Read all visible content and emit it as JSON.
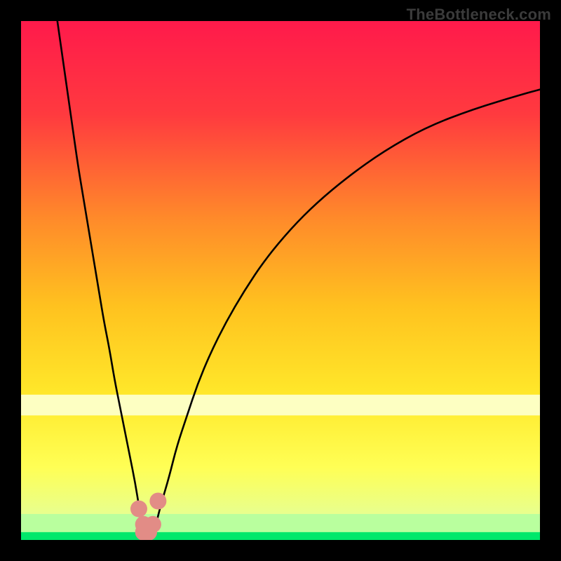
{
  "watermark": "TheBottleneck.com",
  "chart_data": {
    "type": "line",
    "title": "",
    "xlabel": "",
    "ylabel": "",
    "xlim": [
      0,
      100
    ],
    "ylim": [
      0,
      100
    ],
    "grid": false,
    "gradient_colors": {
      "top": "#FF1A4B",
      "upper_mid": "#FF7A2A",
      "mid": "#FFD21F",
      "lower_mid": "#FFFF66",
      "lower": "#E8FF8E",
      "bottom": "#00E86B"
    },
    "series": [
      {
        "name": "left-curve",
        "kind": "line",
        "stroke": "#000000",
        "x": [
          7.0,
          8.0,
          9.0,
          10.0,
          11.0,
          12.0,
          13.0,
          14.0,
          15.0,
          16.0,
          17.0,
          18.0,
          19.0,
          20.0,
          21.0,
          22.0,
          22.8,
          23.3
        ],
        "y": [
          100.0,
          93.0,
          86.0,
          79.0,
          72.0,
          66.0,
          60.0,
          54.0,
          48.0,
          42.0,
          37.0,
          31.0,
          26.0,
          21.0,
          16.0,
          11.0,
          6.0,
          3.0
        ]
      },
      {
        "name": "right-curve",
        "kind": "line",
        "stroke": "#000000",
        "x": [
          26.0,
          27.0,
          28.5,
          30.0,
          32.0,
          34.0,
          36.5,
          39.5,
          43.0,
          47.0,
          52.0,
          57.0,
          63.0,
          70.0,
          78.0,
          87.0,
          97.0,
          100.0
        ],
        "y": [
          3.0,
          7.0,
          12.0,
          18.0,
          24.0,
          30.0,
          36.0,
          42.0,
          48.0,
          54.0,
          60.0,
          65.0,
          70.0,
          75.0,
          79.5,
          83.0,
          86.0,
          86.8
        ]
      },
      {
        "name": "bottom-band-light-yellow",
        "kind": "band",
        "fill": "#FDFFC2",
        "y0": 24.0,
        "y1": 28.0
      },
      {
        "name": "bottom-band-pale-green",
        "kind": "band",
        "fill": "#B9FF9E",
        "y0": 1.5,
        "y1": 5.0
      },
      {
        "name": "bottom-band-green",
        "kind": "band",
        "fill": "#00E86B",
        "y0": 0.0,
        "y1": 1.5
      },
      {
        "name": "marker-cluster",
        "kind": "scatter",
        "fill": "#E28C86",
        "radius": 12,
        "x": [
          22.7,
          23.6,
          23.6,
          24.6,
          25.4,
          26.4
        ],
        "y": [
          6.0,
          3.0,
          1.5,
          1.5,
          3.0,
          7.5
        ]
      }
    ]
  }
}
